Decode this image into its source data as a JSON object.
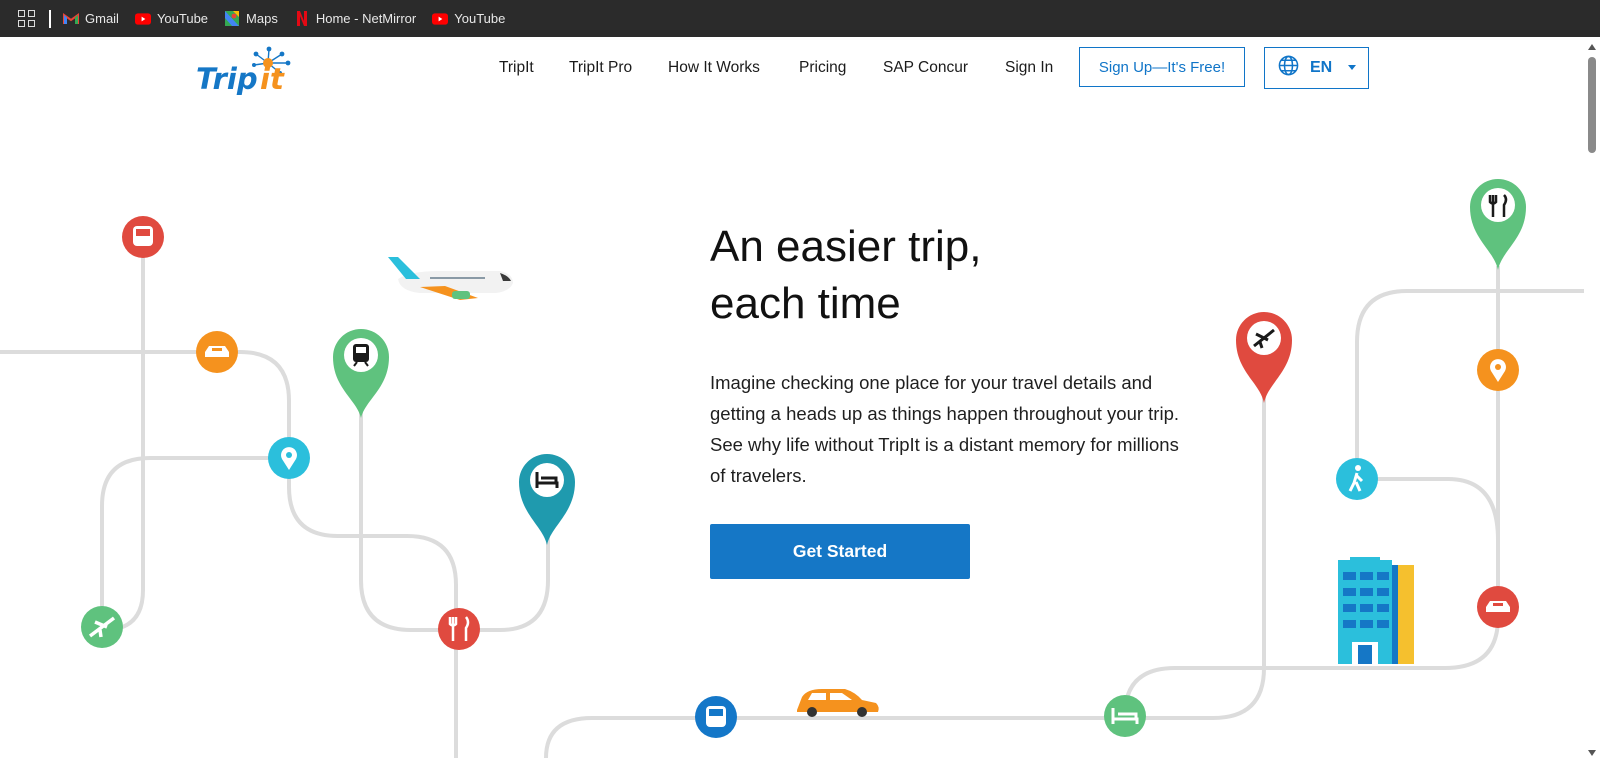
{
  "bookmarks": [
    {
      "label": "Gmail",
      "icon": "gmail-icon"
    },
    {
      "label": "YouTube",
      "icon": "youtube-icon"
    },
    {
      "label": "Maps",
      "icon": "maps-icon"
    },
    {
      "label": "Home - NetMirror",
      "icon": "netflix-icon"
    },
    {
      "label": "YouTube",
      "icon": "youtube-icon"
    }
  ],
  "nav": {
    "links": [
      "TripIt",
      "TripIt Pro",
      "How It Works",
      "Pricing",
      "SAP Concur",
      "Sign In"
    ],
    "signup_label": "Sign Up—It's Free!",
    "language": "EN"
  },
  "hero": {
    "title_line1": "An easier trip,",
    "title_line2": "each time",
    "body": "Imagine checking one place for your travel details and getting a heads up as things happen throughout your trip. See why life without TripIt is a distant memory for millions of travelers.",
    "cta_label": "Get Started"
  },
  "colors": {
    "brand_blue": "#1577c6",
    "red": "#e04a3f",
    "orange": "#f5921e",
    "green": "#5fc27e",
    "cyan": "#2bbfdc",
    "teal": "#1f9aae",
    "blue": "#1477c8",
    "route": "#dcdcdc"
  }
}
